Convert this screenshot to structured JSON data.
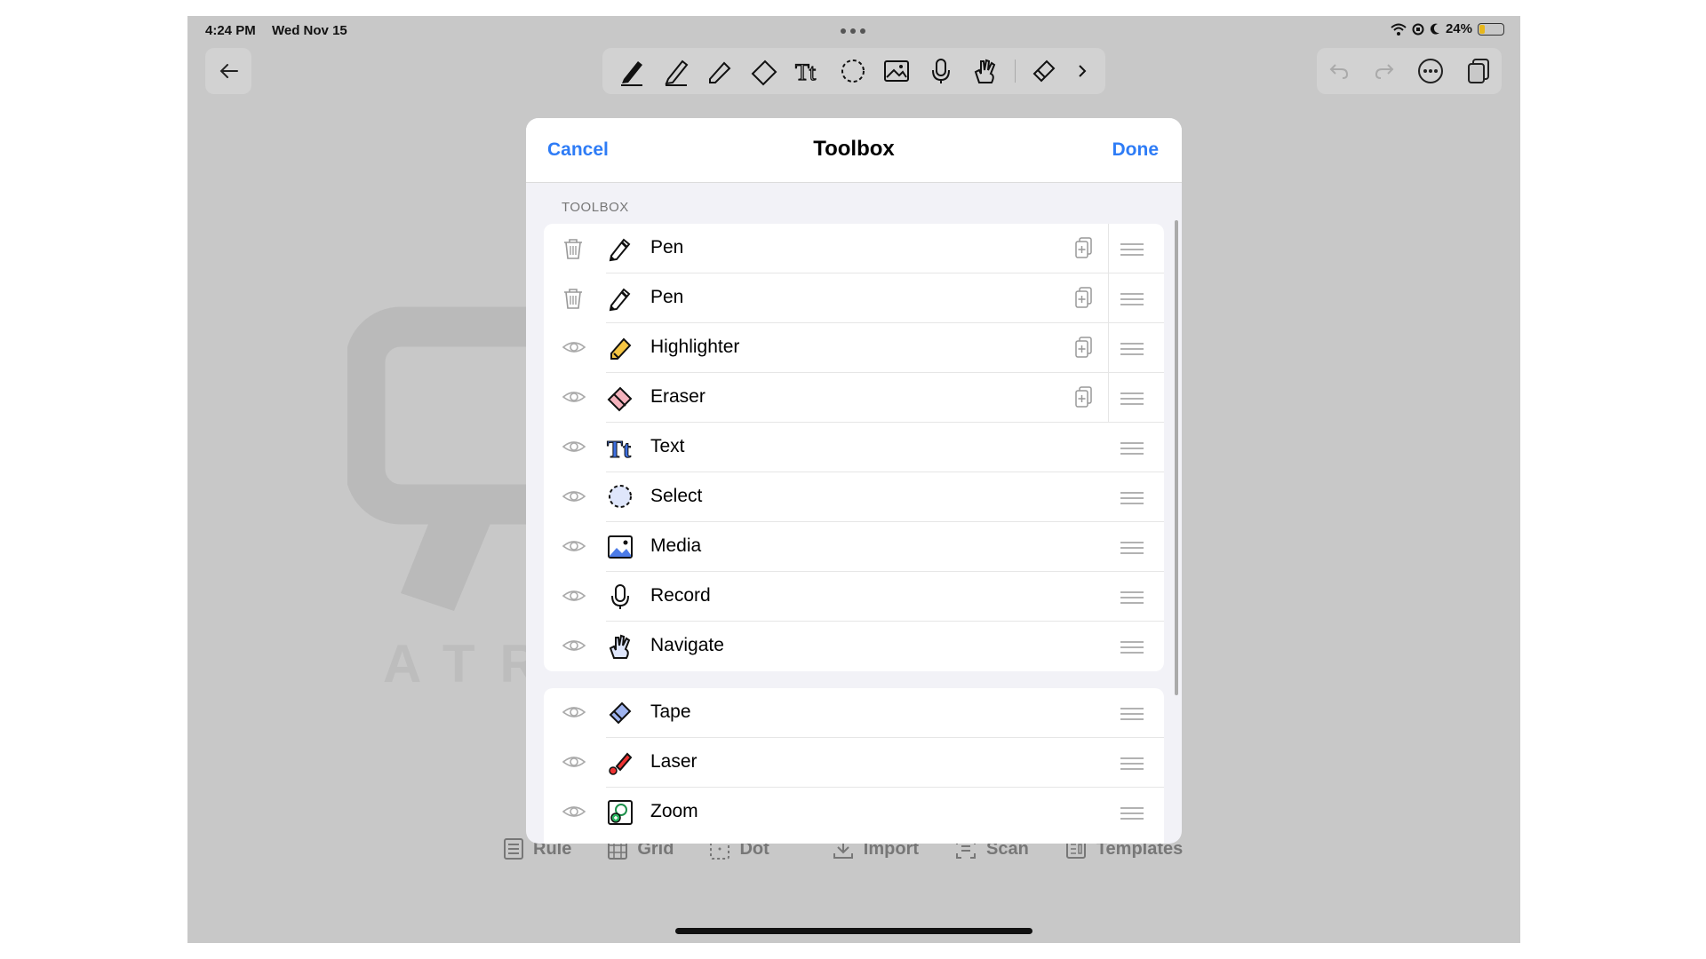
{
  "status_bar": {
    "time": "4:24 PM",
    "date": "Wed Nov 15",
    "battery": "24%",
    "battery_level": 0.24
  },
  "toolbar": {
    "back_icon": "arrow-left-icon",
    "tools": [
      "pen-icon",
      "pen-icon",
      "highlighter-icon",
      "eraser-icon",
      "text-icon",
      "lasso-icon",
      "image-icon",
      "microphone-icon",
      "hand-icon",
      "tape-icon",
      "chevron-right-icon"
    ],
    "right_actions": [
      "undo-icon",
      "redo-icon",
      "more-icon",
      "pages-icon"
    ]
  },
  "background": {
    "watermark": "ATRO ACADEMY",
    "bottom_items": [
      "Rule",
      "Grid",
      "Dot",
      "Import",
      "Scan",
      "Templates"
    ]
  },
  "modal": {
    "cancel": "Cancel",
    "title": "Toolbox",
    "done": "Done",
    "section": "TOOLBOX",
    "items": [
      {
        "label": "Pen",
        "icon": "pen-icon"
      },
      {
        "label": "Pen",
        "icon": "pen-icon"
      },
      {
        "label": "Highlighter",
        "icon": "highlighter-icon"
      },
      {
        "label": "Eraser",
        "icon": "eraser-icon"
      },
      {
        "label": "Text",
        "icon": "text-icon"
      },
      {
        "label": "Select",
        "icon": "lasso-icon"
      },
      {
        "label": "Media",
        "icon": "image-icon"
      },
      {
        "label": "Record",
        "icon": "microphone-icon"
      },
      {
        "label": "Navigate",
        "icon": "hand-icon"
      }
    ],
    "extra_items": [
      {
        "label": "Tape",
        "icon": "tape-icon"
      },
      {
        "label": "Laser",
        "icon": "laser-icon"
      },
      {
        "label": "Zoom",
        "icon": "zoom-icon"
      }
    ]
  },
  "colors": {
    "accent": "#2e7cf6",
    "dim": "#c8c8c8",
    "sheet": "#f2f2f7"
  }
}
